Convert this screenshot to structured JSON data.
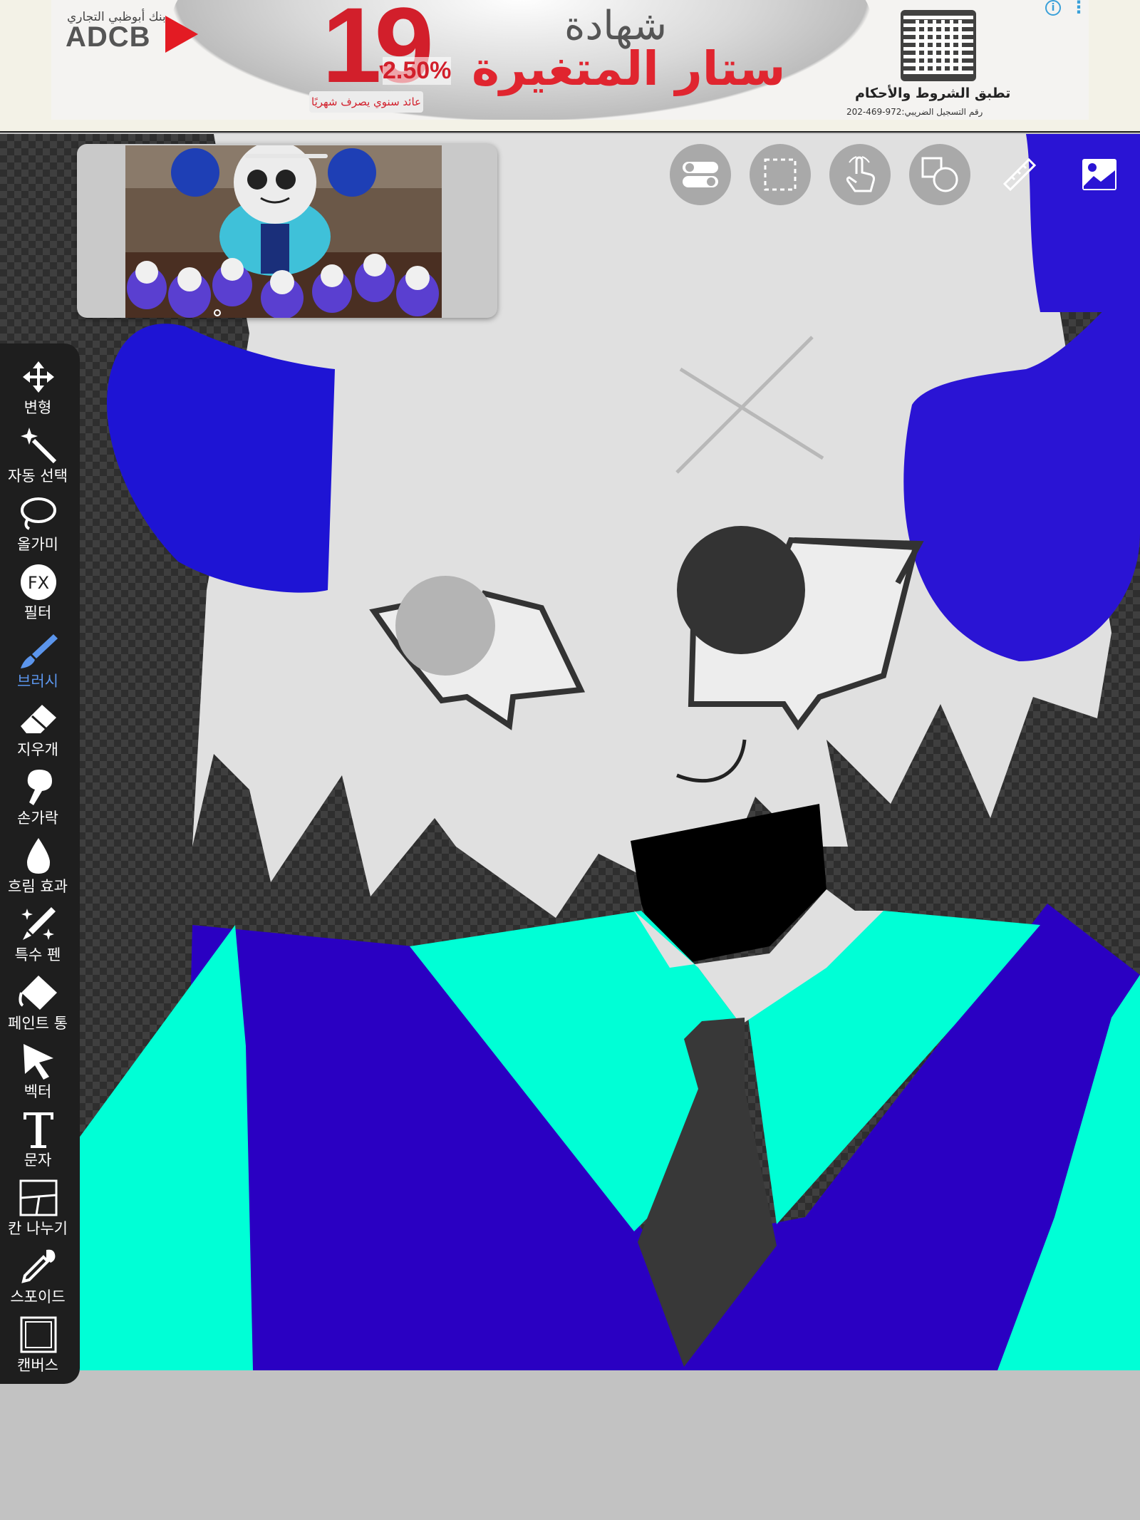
{
  "ad": {
    "bank_name_ar": "بنك أبوظبي التجاري",
    "bank_logo": "ADCB",
    "rate_big": "19",
    "rate_small": "2.50%",
    "rate_caption": "عائد سنوي يصرف شهريًا",
    "headline_1": "شهادة",
    "headline_2": "ستار المتغيرة",
    "terms": "تطبق الشروط والأحكام",
    "registration": "رقم التسجيل الضريبي:972-469-202",
    "info_icon": "info-icon",
    "menu_icon": "more-vertical-icon"
  },
  "top_toolbar": [
    {
      "name": "toggle-button",
      "icon": "toggle-icon"
    },
    {
      "name": "selection-button",
      "icon": "dashed-rectangle-icon"
    },
    {
      "name": "touch-button",
      "icon": "hand-pointer-icon"
    },
    {
      "name": "shape-button",
      "icon": "shape-icon"
    },
    {
      "name": "ruler-button",
      "icon": "ruler-icon"
    },
    {
      "name": "image-button",
      "icon": "image-icon"
    }
  ],
  "tools": [
    {
      "label": "변형",
      "icon": "move-arrows-icon"
    },
    {
      "label": "자동 선택",
      "icon": "magic-wand-icon"
    },
    {
      "label": "올가미",
      "icon": "lasso-icon"
    },
    {
      "label": "필터",
      "icon": "fx-icon"
    },
    {
      "label": "브러시",
      "icon": "brush-icon",
      "active": true
    },
    {
      "label": "지우개",
      "icon": "eraser-icon"
    },
    {
      "label": "손가락",
      "icon": "finger-icon"
    },
    {
      "label": "흐림 효과",
      "icon": "droplet-icon"
    },
    {
      "label": "특수 펜",
      "icon": "sparkle-pen-icon"
    },
    {
      "label": "페인트 통",
      "icon": "paint-bucket-icon"
    },
    {
      "label": "벡터",
      "icon": "cursor-arrow-icon"
    },
    {
      "label": "문자",
      "icon": "text-icon"
    },
    {
      "label": "칸 나누기",
      "icon": "frame-divider-icon"
    },
    {
      "label": "스포이드",
      "icon": "eyedropper-icon"
    },
    {
      "label": "캔버스",
      "icon": "canvas-icon"
    }
  ],
  "colors": {
    "accent": "#5b95ec",
    "toolbar_bg": "#1e1e1e",
    "skin": "#e0e0e0",
    "horn_blue": "#2a14d4",
    "shirt_cyan": "#00ffd6",
    "vest_purple": "#2a00c2",
    "tie_gray": "#383838"
  }
}
